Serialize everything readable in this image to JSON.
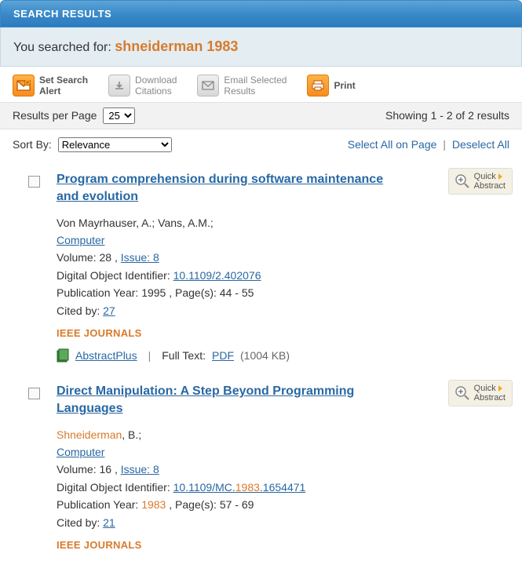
{
  "header": {
    "title": "SEARCH RESULTS"
  },
  "search": {
    "label": "You searched for: ",
    "term": "shneiderman 1983"
  },
  "toolbar": {
    "alert": "Set Search\nAlert",
    "download": "Download\nCitations",
    "email": "Email Selected\nResults",
    "print": "Print"
  },
  "results_bar": {
    "per_page_label": "Results per Page",
    "per_page_value": "25",
    "showing": "Showing 1 - 2 of 2 results"
  },
  "sort": {
    "label": "Sort By:",
    "value": "Relevance",
    "select_all": "Select All on Page",
    "deselect_all": "Deselect All"
  },
  "source_label": "IEEE JOURNALS",
  "access": {
    "abstractplus": "AbstractPlus ",
    "fulltext_label": "Full Text:",
    "pdf": "PDF"
  },
  "quick_abstract": {
    "line1": "Quick",
    "line2": "Abstract"
  },
  "results": [
    {
      "title": "Program comprehension during software maintenance and evolution",
      "authors": "Von Mayrhauser, A.; Vans, A.M.;",
      "journal": "Computer",
      "volume_prefix": "Volume: 28 , ",
      "issue": "Issue: 8",
      "doi_label": "Digital Object Identifier: ",
      "doi": "10.1109/2.402076",
      "pub_prefix": "Publication Year: 1995 , Page(s): 44 - 55",
      "pub_year_hl": "",
      "cited_label": "Cited by: ",
      "cited": "27",
      "filesize": "(1004 KB)",
      "author_hl": ""
    },
    {
      "title": "Direct Manipulation: A Step Beyond Programming Languages",
      "author_hl": "Shneiderman",
      "authors_rest": ", B.;",
      "journal": "Computer",
      "volume_prefix": "Volume: 16 , ",
      "issue": "Issue: 8",
      "doi_label": "Digital Object Identifier: ",
      "doi_pre": "10.1109/MC.",
      "doi_hl": "1983",
      "doi_post": ".1654471",
      "pub_prefix": "Publication Year: ",
      "pub_year_hl": "1983",
      "pub_suffix": " , Page(s): 57 - 69",
      "cited_label": "Cited by: ",
      "cited": "21"
    }
  ]
}
